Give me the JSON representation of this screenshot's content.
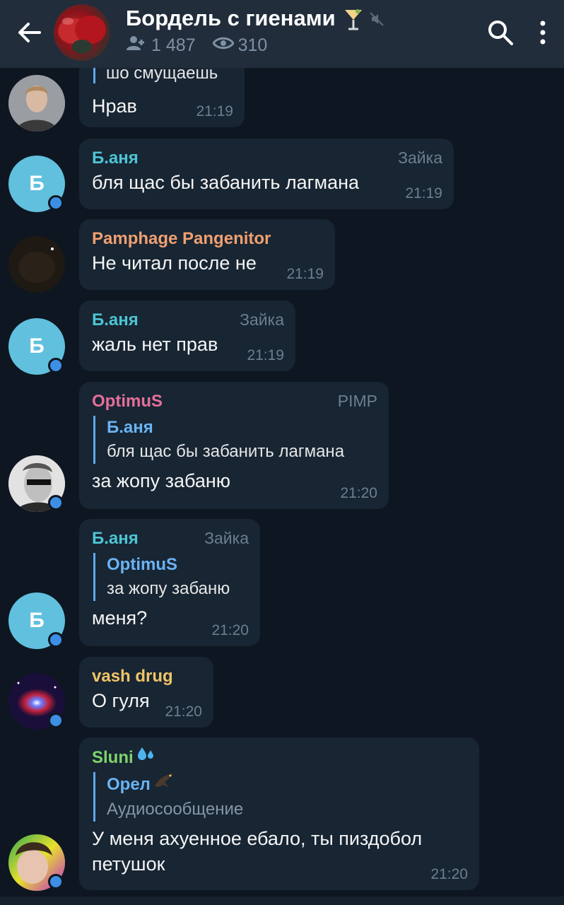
{
  "header": {
    "title": "Бордель с гиенами",
    "members_count": "1 487",
    "online_count": "310",
    "title_emoji": "cocktail-icon",
    "muted_icon": "muted-icon"
  },
  "colors": {
    "background": "#0e1621",
    "header": "#212d3b",
    "bubble": "#182533",
    "accent": "#3d8fe5",
    "name_cyan": "#4dc5d4",
    "name_orange": "#f0a070",
    "name_pink": "#e56f9a",
    "name_yellow": "#f0c465",
    "name_green": "#7fd46a"
  },
  "messages": [
    {
      "quote_fragment": "шо смущаешь",
      "text": "Нрав",
      "time": "21:19"
    },
    {
      "avatar_letter": "Б",
      "sender": "Б.аня",
      "role": "Зайка",
      "text": "бля щас бы забанить лагмана",
      "time": "21:19"
    },
    {
      "sender": "Pamphage Pangenitor",
      "text": "Не читал после не",
      "time": "21:19"
    },
    {
      "avatar_letter": "Б",
      "sender": "Б.аня",
      "role": "Зайка",
      "text": "жаль нет прав",
      "time": "21:19"
    },
    {
      "sender": "OptimuS",
      "role": "PIMP",
      "quote_name": "Б.аня",
      "quote_text": "бля щас бы забанить лагмана",
      "text": "за жопу забаню",
      "time": "21:20"
    },
    {
      "avatar_letter": "Б",
      "sender": "Б.аня",
      "role": "Зайка",
      "quote_name": "OptimuS",
      "quote_text": "за жопу забаню",
      "text": "меня?",
      "time": "21:20"
    },
    {
      "sender": "vash drug",
      "text": "О гуля",
      "time": "21:20"
    },
    {
      "sender": "Sluni",
      "sender_emoji": "sweat-droplets-icon",
      "quote_name": "Орел",
      "quote_emoji": "eagle-icon",
      "quote_text": "Аудиосообщение",
      "text_line1": "У меня ахуенное ебало, ты пиздобол",
      "text_line2": "петушок",
      "time": "21:20"
    }
  ]
}
